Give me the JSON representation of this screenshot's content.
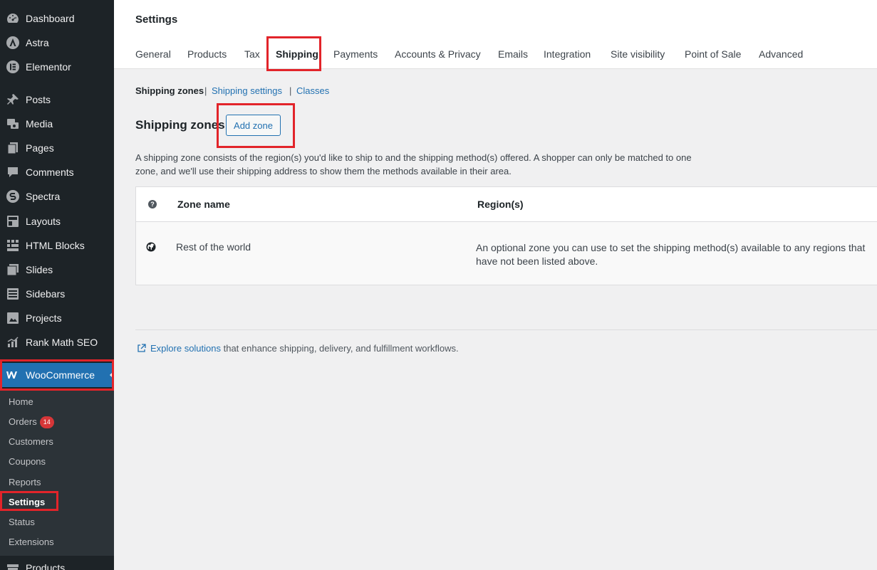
{
  "sidebar": {
    "items": [
      {
        "label": "Dashboard",
        "icon": "dashboard-icon"
      },
      {
        "label": "Astra",
        "icon": "astra-icon"
      },
      {
        "label": "Elementor",
        "icon": "elementor-icon"
      },
      {
        "label": "Posts",
        "icon": "pushpin-icon"
      },
      {
        "label": "Media",
        "icon": "media-icon"
      },
      {
        "label": "Pages",
        "icon": "pages-icon"
      },
      {
        "label": "Comments",
        "icon": "comments-icon"
      },
      {
        "label": "Spectra",
        "icon": "spectra-icon"
      },
      {
        "label": "Layouts",
        "icon": "layouts-icon"
      },
      {
        "label": "HTML Blocks",
        "icon": "html-blocks-icon"
      },
      {
        "label": "Slides",
        "icon": "slides-icon"
      },
      {
        "label": "Sidebars",
        "icon": "sidebars-icon"
      },
      {
        "label": "Projects",
        "icon": "projects-icon"
      },
      {
        "label": "Rank Math SEO",
        "icon": "rank-math-icon"
      },
      {
        "label": "WooCommerce",
        "icon": "woocommerce-icon"
      },
      {
        "label": "Products",
        "icon": "products-icon"
      }
    ],
    "submenu": [
      {
        "label": "Home"
      },
      {
        "label": "Orders",
        "badge": "14"
      },
      {
        "label": "Customers"
      },
      {
        "label": "Coupons"
      },
      {
        "label": "Reports"
      },
      {
        "label": "Settings"
      },
      {
        "label": "Status"
      },
      {
        "label": "Extensions"
      }
    ]
  },
  "header": {
    "title": "Settings",
    "tabs": [
      {
        "label": "General"
      },
      {
        "label": "Products"
      },
      {
        "label": "Tax"
      },
      {
        "label": "Shipping"
      },
      {
        "label": "Payments"
      },
      {
        "label": "Accounts & Privacy"
      },
      {
        "label": "Emails"
      },
      {
        "label": "Integration"
      },
      {
        "label": "Site visibility"
      },
      {
        "label": "Point of Sale"
      },
      {
        "label": "Advanced"
      }
    ]
  },
  "subnav": {
    "current": "Shipping zones",
    "separator": "|",
    "links": [
      "Shipping settings",
      "Classes"
    ]
  },
  "zones": {
    "heading": "Shipping zones",
    "add_button": "Add zone",
    "description": "A shipping zone consists of the region(s) you'd like to ship to and the shipping method(s) offered. A shopper can only be matched to one zone, and we'll use their shipping address to show them the methods available in their area.",
    "table": {
      "help": "?",
      "columns": [
        "Zone name",
        "Region(s)"
      ],
      "rows": [
        {
          "name": "Rest of the world",
          "region": "An optional zone you can use to set the shipping method(s) available to any regions that have not been listed above."
        }
      ]
    }
  },
  "explore": {
    "link": "Explore solutions",
    "text": " that enhance shipping, delivery, and fulfillment workflows."
  },
  "colors": {
    "accent": "#2271b1",
    "sidebar_bg": "#1d2327",
    "submenu_bg": "#2c3338",
    "highlight_box": "#e2242a",
    "badge": "#d63638"
  }
}
